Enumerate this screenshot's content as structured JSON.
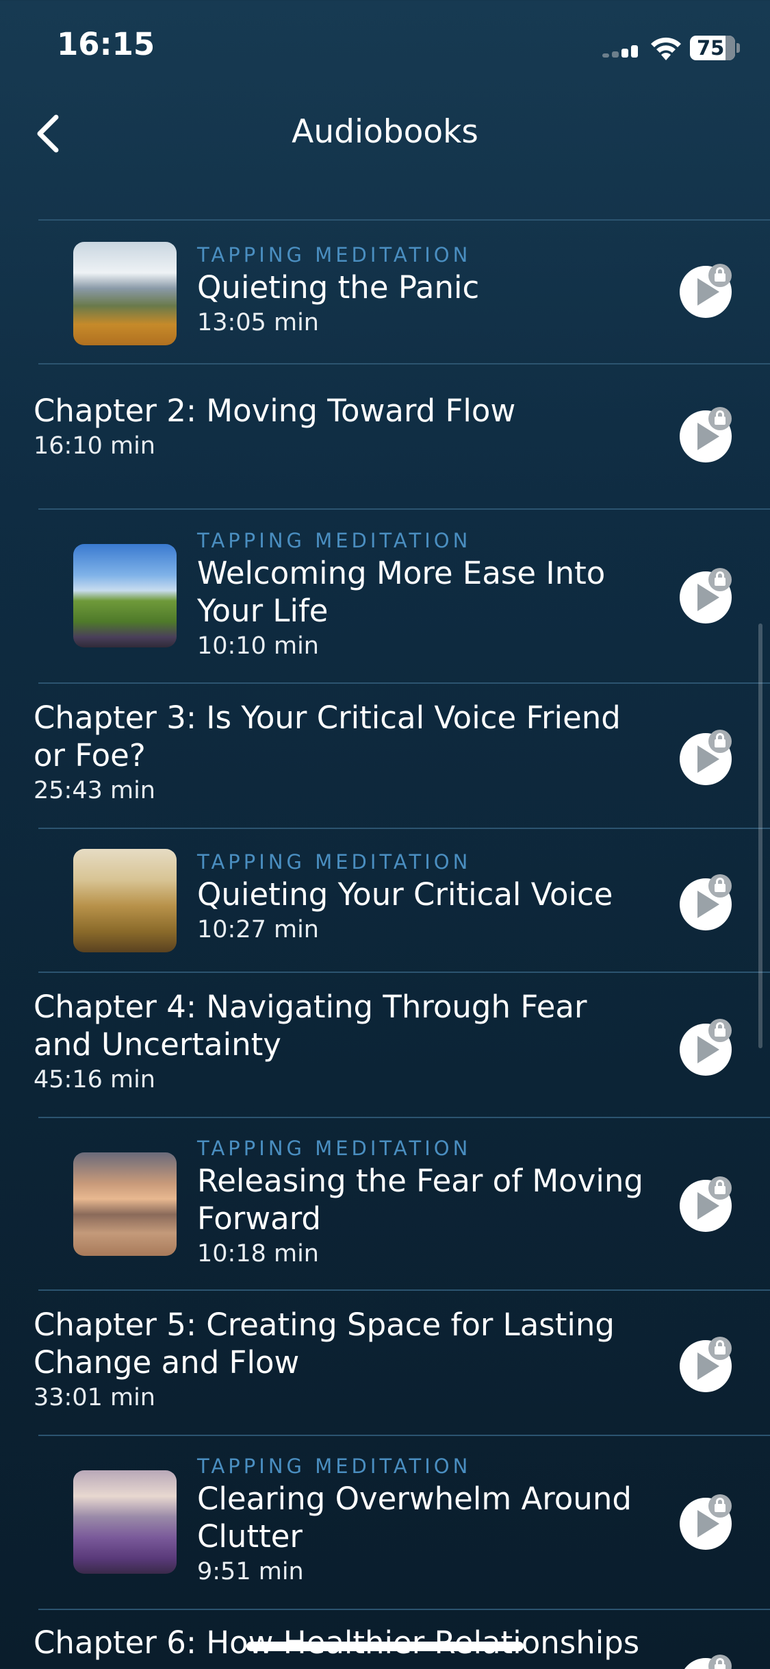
{
  "status_bar": {
    "time": "16:15",
    "battery_level": "75"
  },
  "header": {
    "title": "Audiobooks"
  },
  "items": [
    {
      "type": "meditation",
      "label": "TAPPING MEDITATION",
      "title": "Quieting the Panic",
      "duration": "13:05 min",
      "thumbnail": "mountain-field-photo",
      "locked": true
    },
    {
      "type": "chapter",
      "title": "Chapter 2: Moving Toward Flow",
      "duration": "16:10 min",
      "locked": true
    },
    {
      "type": "meditation",
      "label": "TAPPING MEDITATION",
      "title": "Welcoming More Ease Into Your Life",
      "duration": "10:10 min",
      "thumbnail": "green-hill-sky-photo",
      "locked": true
    },
    {
      "type": "chapter",
      "title": "Chapter 3: Is Your Critical Voice Friend or Foe?",
      "duration": "25:43 min",
      "locked": true
    },
    {
      "type": "meditation",
      "label": "TAPPING MEDITATION",
      "title": "Quieting Your Critical Voice",
      "duration": "10:27 min",
      "thumbnail": "wheat-field-photo",
      "locked": true
    },
    {
      "type": "chapter",
      "title": "Chapter 4: Navigating Through Fear and Uncertainty",
      "duration": "45:16 min",
      "locked": true
    },
    {
      "type": "meditation",
      "label": "TAPPING MEDITATION",
      "title": "Releasing the Fear of Moving Forward",
      "duration": "10:18 min",
      "thumbnail": "beach-sunset-photo",
      "locked": true
    },
    {
      "type": "chapter",
      "title": "Chapter 5: Creating Space for Lasting Change and Flow",
      "duration": "33:01 min",
      "locked": true
    },
    {
      "type": "meditation",
      "label": "TAPPING MEDITATION",
      "title": "Clearing Overwhelm Around Clutter",
      "duration": "9:51 min",
      "thumbnail": "lavender-field-photo",
      "locked": true
    },
    {
      "type": "chapter",
      "title": "Chapter 6: How Healthier Relationships",
      "duration": "",
      "locked": true
    }
  ],
  "colors": {
    "accent_label": "#4a8ec0",
    "background_top": "#173a52",
    "background_bottom": "#0a1d2c",
    "divider": "#2c5470"
  },
  "icons": {
    "back": "chevron-left-icon",
    "play": "play-icon",
    "lock": "lock-icon"
  }
}
